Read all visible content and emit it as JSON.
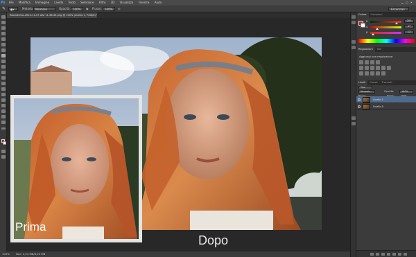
{
  "app": {
    "logo": "Ps"
  },
  "menu": {
    "items": [
      "File",
      "Modifica",
      "Immagine",
      "Livello",
      "Testo",
      "Selezione",
      "Filtro",
      "3D",
      "Visualizza",
      "Finestra",
      "Aiuto"
    ]
  },
  "options_bar": {
    "style_label": "Metodo:",
    "style_value": "Normale",
    "opacity_label": "Opacità:",
    "opacity_value": "100%",
    "flow_label": "Flusso:",
    "flow_value": "100%",
    "workspace": "Essenziali"
  },
  "document": {
    "tab_title": "Rolandreno-2014-11-07 alle 11.46.45.png @ 100% (Livello 1, RGB/8) *"
  },
  "canvas": {
    "label_before": "Prima",
    "label_after": "Dopo"
  },
  "status_bar": {
    "zoom": "100%",
    "doc_info": "Doc: 4,24 MB/4,24 MB"
  },
  "panels": {
    "color": {
      "tabs": [
        "Colore",
        "Campioni"
      ],
      "sliders": [
        {
          "letter": "R",
          "value": "207"
        },
        {
          "letter": "G",
          "value": "47"
        },
        {
          "letter": "B",
          "value": "12"
        }
      ]
    },
    "adjustments": {
      "tabs": [
        "Regolazioni",
        "Stili"
      ],
      "title": "Aggiungi una regolazione"
    },
    "layers": {
      "tabs": [
        "Livelli",
        "Canali",
        "Tracciati"
      ],
      "kind_label": "Tipo",
      "blend_mode": "Normale",
      "opacity_label": "Opacità:",
      "opacity_value": "100%",
      "lock_label": "Blocca:",
      "fill_label": "Riemp.:",
      "fill_value": "100%",
      "items": [
        {
          "name": "Livello 1"
        },
        {
          "name": "Livello 0"
        }
      ]
    }
  },
  "colors": {
    "foreground": "#c0281b",
    "background": "#ffffff",
    "selected_layer": "#4f6b8c"
  },
  "icons": [
    "photoshop-logo-icon",
    "move-tool-icon",
    "marquee-tool-icon",
    "lasso-tool-icon",
    "brush-tool-icon",
    "eye-icon"
  ]
}
